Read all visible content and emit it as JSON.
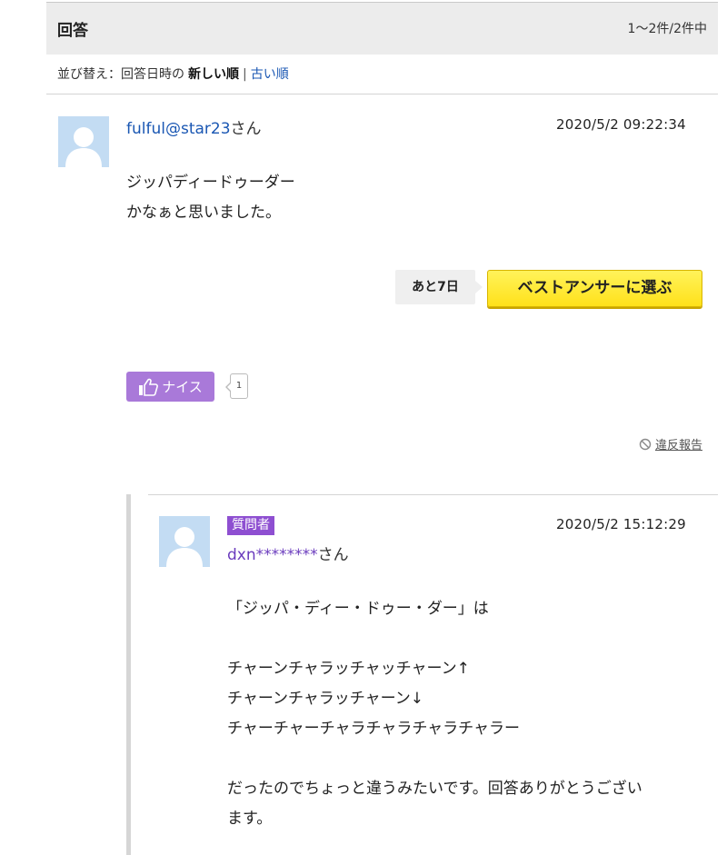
{
  "header": {
    "title": "回答",
    "count": "1〜2件/2件中"
  },
  "sort": {
    "prefix": "並び替え：回答日時の",
    "active": "新しい順",
    "separator": "|",
    "alt": "古い順"
  },
  "answer": {
    "username": "fulful@star23",
    "suffix": "さん",
    "timestamp": "2020/5/2  09:22:34",
    "lines": [
      "ジッパディードゥーダー",
      "かなぁと思いました。"
    ],
    "remaining_label": "あと7日",
    "best_answer_label": "ベストアンサーに選ぶ",
    "nice_label": "ナイス",
    "nice_count": "1",
    "report_label": "違反報告"
  },
  "reply": {
    "badge": "質問者",
    "username": "dxn********",
    "suffix": "さん",
    "timestamp": "2020/5/2  15:12:29",
    "lines": [
      "「ジッパ・ディー・ドゥー・ダー」は",
      "",
      "チャーンチャラッチャッチャーン↑",
      "チャーンチャラッチャーン↓",
      "チャーチャーチャラチャラチャラチャラー",
      "",
      "だったのでちょっと違うみたいです。回答ありがとうござい",
      "ます。"
    ]
  },
  "colors": {
    "link": "#1a57b3",
    "nice_button": "#a979d9",
    "asker_badge": "#8e4fd1",
    "best_button": "#ffe11a",
    "avatar_bg": "#c3dcf3"
  },
  "icons": {
    "avatar": "default-user-silhouette",
    "nice": "thumbs-up-icon",
    "report": "prohibited-icon"
  }
}
